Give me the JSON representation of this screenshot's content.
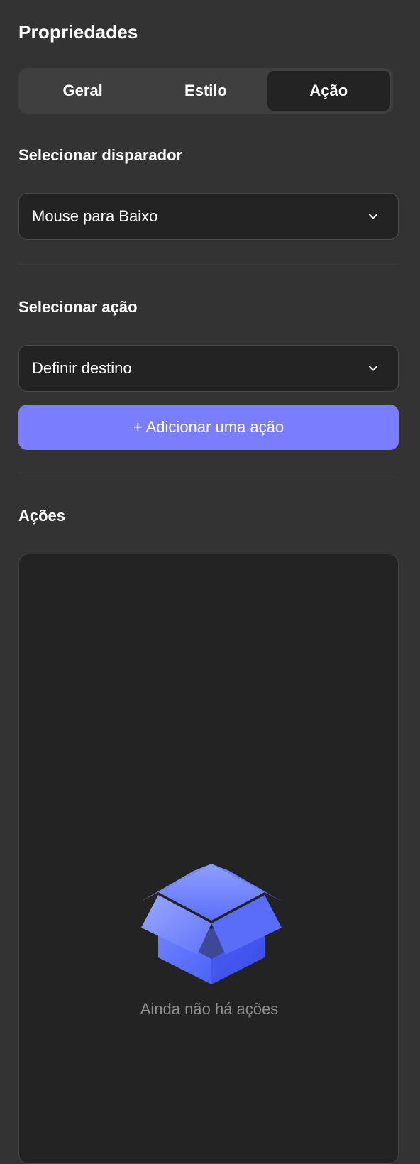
{
  "panel": {
    "title": "Propriedades"
  },
  "tabs": [
    {
      "label": "Geral",
      "active": false
    },
    {
      "label": "Estilo",
      "active": false
    },
    {
      "label": "Ação",
      "active": true
    }
  ],
  "trigger": {
    "label": "Selecionar disparador",
    "value": "Mouse para Baixo",
    "icon": "chevron-down-icon"
  },
  "action": {
    "label": "Selecionar ação",
    "value": "Definir destino",
    "icon": "chevron-down-icon"
  },
  "add_button": {
    "label": "+ Adicionar uma ação",
    "color": "#7b7dff"
  },
  "actions_list": {
    "label": "Ações",
    "empty_text": "Ainda não há ações",
    "empty_icon": "open-box-icon"
  },
  "colors": {
    "background": "#333333",
    "field_background": "#232323",
    "accent": "#7b7dff",
    "box_illustration": "#5b6cff"
  }
}
